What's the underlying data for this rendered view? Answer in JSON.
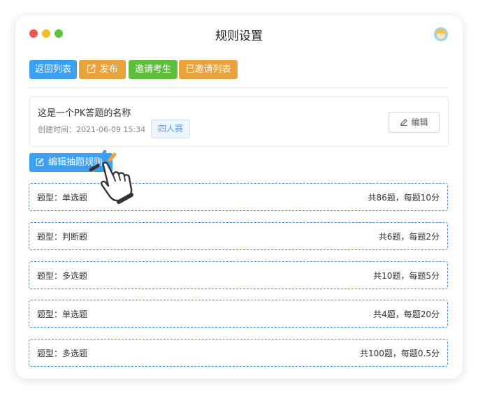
{
  "window": {
    "title": "规则设置"
  },
  "toolbar": {
    "back_label": "返回列表",
    "publish_label": "发布",
    "invite_label": "邀请考生",
    "invited_label": "已邀请列表"
  },
  "card": {
    "name": "这是一个PK答题的名称",
    "created": "创建时间：2021-06-09  15:34",
    "badge": "四人赛",
    "edit_label": "编辑"
  },
  "rules_button": {
    "label": "编辑抽题规则"
  },
  "rules": [
    {
      "type": "题型：单选题",
      "summary": "共86题，每题10分"
    },
    {
      "type": "题型：判断题",
      "summary": "共6题，每题2分"
    },
    {
      "type": "题型：多选题",
      "summary": "共10题，每题5分"
    },
    {
      "type": "题型：单选题",
      "summary": "共4题，每题20分"
    },
    {
      "type": "题型：多选题",
      "summary": "共100题，每题0.5分"
    }
  ],
  "colors": {
    "primary": "#3d9ff2",
    "warning": "#e8a33d",
    "success": "#5fbf3c",
    "dashed_border": "#4a90e2"
  },
  "icons": [
    "avatar",
    "publish-icon",
    "edit-icon",
    "pointer-hand-icon"
  ]
}
